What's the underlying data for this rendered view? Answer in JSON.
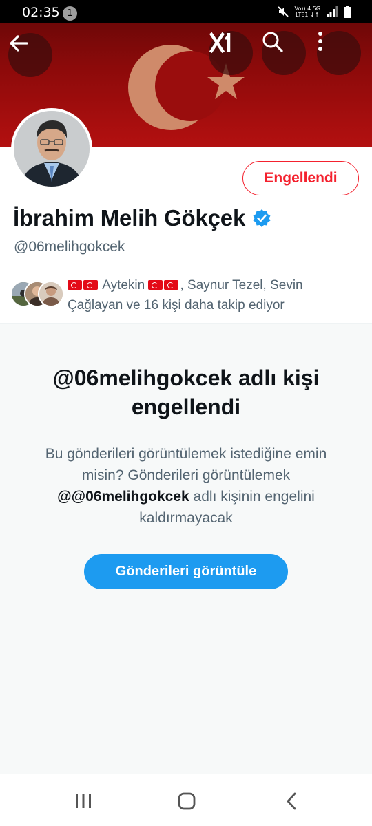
{
  "status_bar": {
    "time": "02:35",
    "notification_count": "1",
    "network_top": "Vo)) 4.5G",
    "network_bottom": "LTE1 ↓↑"
  },
  "header": {
    "icons": [
      "back-arrow-icon",
      "grok-icon",
      "search-icon",
      "more-vertical-icon"
    ]
  },
  "profile": {
    "display_name": "İbrahim Melih Gökçek",
    "verified": true,
    "handle": "@06melihgokcek",
    "blocked_button_label": "Engellendi",
    "followers_text_a": "Aytekin",
    "followers_text_b": ", Saynur Tezel, Sevin Çağlayan ve 16 kişi daha takip ediyor"
  },
  "blocked_notice": {
    "title": "@06melihgokcek adlı kişi engellendi",
    "description_part1": "Bu gönderileri görüntülemek istediğine emin misin? Gönderileri görüntülemek ",
    "description_handle": "@@06melihgokcek",
    "description_part2": " adlı kişinin engelini kaldırmayacak",
    "view_button_label": "Gönderileri görüntüle"
  },
  "colors": {
    "accent_blue": "#1d9bf0",
    "danger_red": "#f4212e",
    "banner_red": "#b31010"
  }
}
